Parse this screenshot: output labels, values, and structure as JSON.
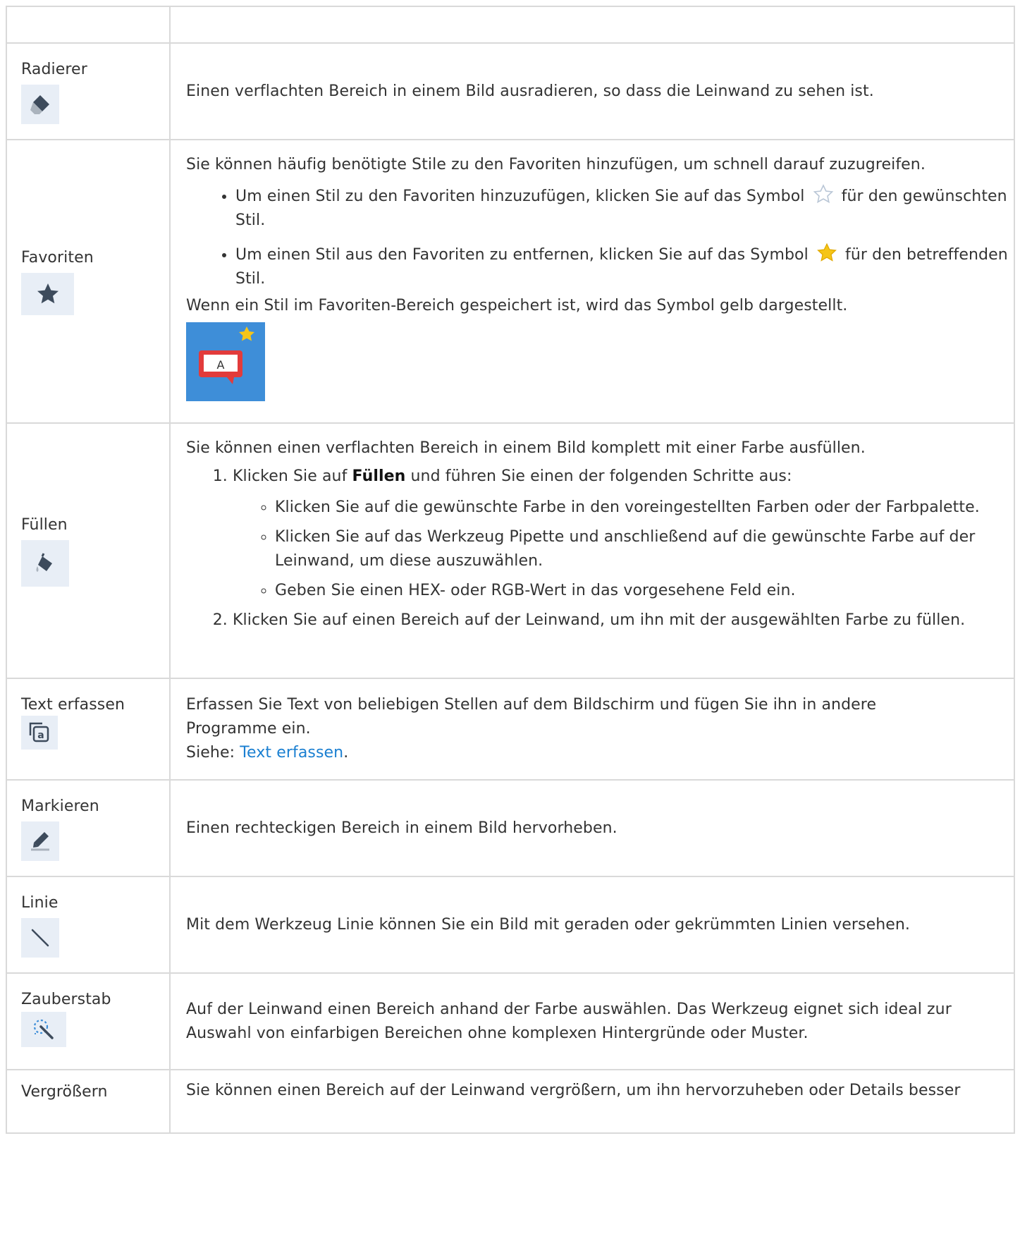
{
  "rows": {
    "radierer": {
      "name": "Radierer",
      "icon": "eraser-icon",
      "text": "Einen verflachten Bereich in einem Bild ausradieren, so dass die Leinwand zu sehen ist."
    },
    "favoriten": {
      "name": "Favoriten",
      "icon": "star-icon",
      "intro": "Sie können häufig benötigte Stile zu den Favoriten hinzufügen, um schnell darauf zuzugreifen.",
      "bullet1_a": "Um einen Stil zu den Favoriten hinzuzufügen, klicken Sie auf das Symbol",
      "bullet1_b": "für den gewünschten Stil.",
      "bullet2_a": "Um einen Stil aus den Favoriten zu entfernen, klicken Sie auf das Symbol",
      "bullet2_b": "für den betreffenden Stil.",
      "note": "Wenn ein Stil im Favoriten-Bereich gespeichert ist, wird das Symbol gelb dargestellt.",
      "badge_letter": "A"
    },
    "fuellen": {
      "name": "Füllen",
      "icon": "paint-bucket-icon",
      "intro": "Sie können einen verflachten Bereich in einem Bild komplett mit einer Farbe ausfüllen.",
      "step1_a": "Klicken Sie auf ",
      "step1_bold": "Füllen",
      "step1_b": " und führen Sie einen der folgenden Schritte aus:",
      "sub1": "Klicken Sie auf die gewünschte Farbe in den voreingestellten Farben oder der Farbpalette.",
      "sub2": "Klicken Sie auf das Werkzeug Pipette und anschließend auf die gewünschte Farbe auf der Leinwand, um diese auszuwählen.",
      "sub3": "Geben Sie einen HEX- oder RGB-Wert in das vorgesehene Feld ein.",
      "step2": "Klicken Sie auf einen Bereich auf der Leinwand, um ihn mit der ausgewählten Farbe zu füllen."
    },
    "text_erfassen": {
      "name": "Text erfassen",
      "icon": "text-capture-icon",
      "text": "Erfassen Sie Text von beliebigen Stellen auf dem Bildschirm und fügen Sie ihn in andere Programme ein.",
      "see_label": "Siehe: ",
      "see_link": "Text erfassen",
      "see_suffix": "."
    },
    "markieren": {
      "name": "Markieren",
      "icon": "highlighter-icon",
      "text": "Einen rechteckigen Bereich in einem Bild hervorheben."
    },
    "linie": {
      "name": "Linie",
      "icon": "line-icon",
      "text": "Mit dem Werkzeug Linie können Sie ein Bild mit geraden oder gekrümmten Linien versehen."
    },
    "zauberstab": {
      "name": "Zauberstab",
      "icon": "magic-wand-icon",
      "text": "Auf der Leinwand einen Bereich anhand der Farbe auswählen. Das Werkzeug eignet sich ideal zur Auswahl von einfarbigen Bereichen ohne komplexen Hintergründe oder Muster."
    },
    "vergroessern": {
      "name": "Vergrößern",
      "text": "Sie können einen Bereich auf der Leinwand vergrößern, um ihn hervorzuheben oder Details besser"
    }
  },
  "colors": {
    "icon_bg": "#e8eef6",
    "icon_fg": "#3d4b5c",
    "link": "#1a7fd1",
    "star_yellow": "#f5c518",
    "badge_bg": "#3e8ed8",
    "bubble_red": "#e23b3b"
  }
}
